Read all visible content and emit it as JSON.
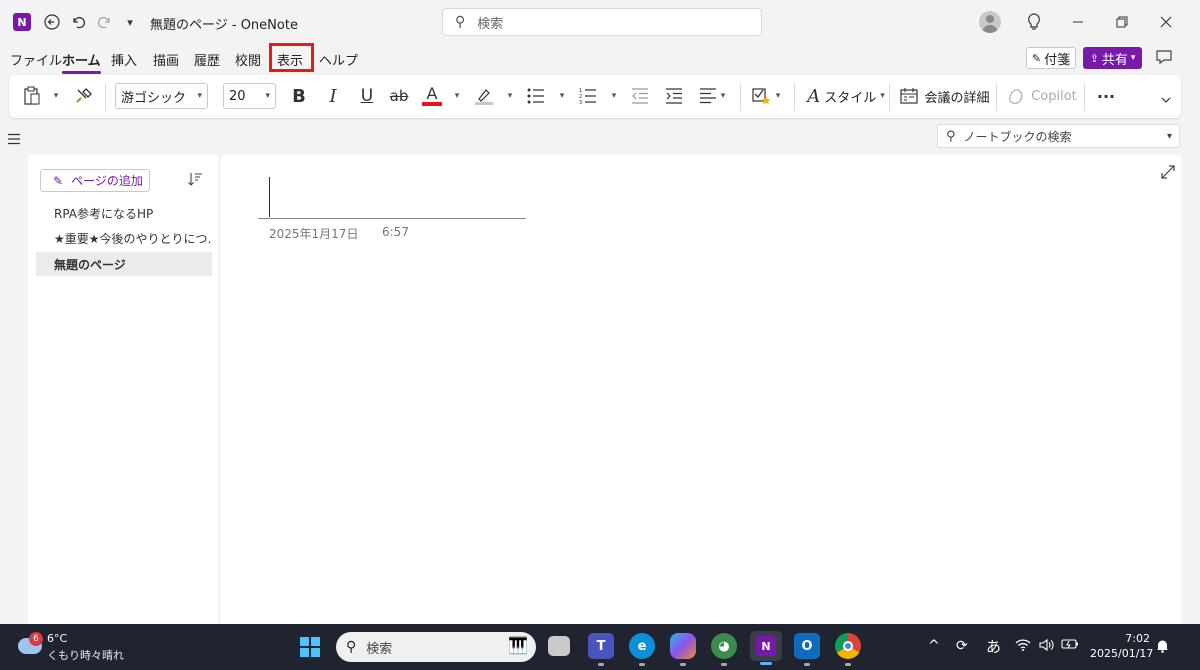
{
  "titlebar": {
    "app_icon": "onenote-icon",
    "doc_title": "無題のページ - OneNote",
    "search_placeholder": "検索",
    "icons": [
      "back-icon",
      "undo-icon",
      "redo-icon",
      "quick-access-dropdown-icon",
      "lightbulb-icon",
      "minimize-icon",
      "restore-icon",
      "close-icon"
    ]
  },
  "menu": {
    "tabs": [
      "ファイル",
      "ホーム",
      "挿入",
      "描画",
      "履歴",
      "校閲",
      "表示",
      "ヘルプ"
    ],
    "active_tab": "ホーム",
    "highlighted_tab": "表示",
    "fusen_label": "付箋",
    "share_label": "共有"
  },
  "ribbon": {
    "font_name": "游ゴシック",
    "font_size": "20",
    "bold": "B",
    "italic": "I",
    "underline": "U",
    "strike": "ab",
    "font_color_letter": "A",
    "styles_label": "スタイル",
    "meeting_label": "会議の詳細",
    "copilot_label": "Copilot",
    "more": "···",
    "colors": {
      "font_color": "#e81123",
      "accent": "#7719aa"
    }
  },
  "notebook_search": {
    "placeholder": "ノートブックの検索"
  },
  "pages": {
    "add_page_label": "ページの追加",
    "items": [
      {
        "title": "RPA参考になるHP"
      },
      {
        "title": "★重要★今後のやりとりにつ…"
      },
      {
        "title": "無題のページ"
      }
    ],
    "selected_index": 2
  },
  "page": {
    "date": "2025年1月17日",
    "time": "6:57"
  },
  "taskbar": {
    "weather_badge": "6",
    "temperature": "6°C",
    "condition": "くもり時々晴れ",
    "search_placeholder": "検索",
    "ime": "あ",
    "time": "7:02",
    "date": "2025/01/17"
  }
}
